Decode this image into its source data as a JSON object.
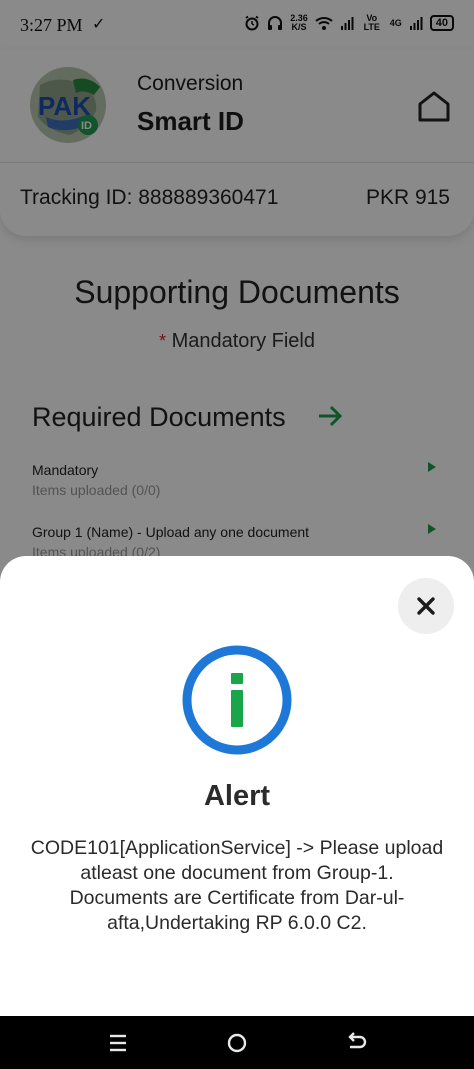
{
  "status_bar": {
    "time": "3:27 PM",
    "speed_value": "2.36",
    "speed_unit": "K/S",
    "signal_label_1": "Vo LTE",
    "signal_label_2": "4G",
    "battery": "40"
  },
  "header": {
    "logo_text": "PAK",
    "logo_sub": "ID",
    "title_small": "Conversion",
    "title_big": "Smart ID",
    "tracking": "Tracking ID: 888889360471",
    "amount": "PKR 915"
  },
  "page": {
    "title": "Supporting Documents",
    "mandatory_star": "*",
    "mandatory_label": "Mandatory Field",
    "section_title": "Required Documents",
    "documents": [
      {
        "name": "Mandatory",
        "status": "Items uploaded (0/0)"
      },
      {
        "name": "Group 1 (Name) - Upload any one document",
        "status": "Items uploaded (0/2)"
      }
    ]
  },
  "alert": {
    "title": "Alert",
    "message": "CODE101[ApplicationService] -> Please upload atleast one document from Group-1. Documents are Certificate from Dar-ul-afta,Undertaking RP 6.0.0 C2."
  },
  "colors": {
    "accent_green": "#1e9c52",
    "info_ring_blue": "#1e78d8",
    "info_i_green": "#19a64a",
    "mandatory_red": "#d3242c",
    "logo_blue": "#1f4fb4"
  }
}
